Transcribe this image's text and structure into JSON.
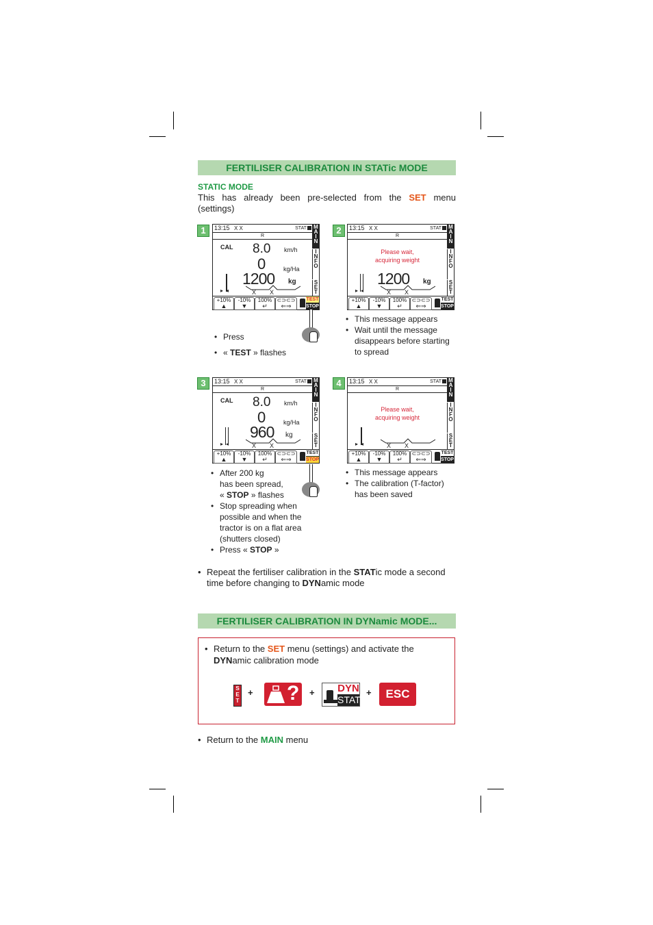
{
  "static_section": {
    "title": "FERTILISER CALIBRATION IN STATic MODE",
    "subtitle": "STATIC MODE",
    "intro_part1": "This has already been pre-selected from the",
    "intro_set": "SET",
    "intro_part2": "menu (settings)"
  },
  "screens": [
    {
      "step": "1",
      "time": "13:15",
      "xx": "X X",
      "stat": "STAT",
      "sub": "R",
      "cal": "CAL",
      "speed": "8.0",
      "speed_unit": "km/h",
      "rate": "0",
      "rate_unit": "kg/Ha",
      "weight": "1200",
      "weight_unit": "kg",
      "message": "",
      "flash": "TEST"
    },
    {
      "step": "2",
      "time": "13:15",
      "xx": "X X",
      "stat": "STAT",
      "sub": "R",
      "message_line1": "Please wait,",
      "message_line2": "acquiring weight",
      "weight": "1200",
      "weight_unit": "kg"
    },
    {
      "step": "3",
      "time": "13:15",
      "xx": "X X",
      "stat": "STAT",
      "sub": "R",
      "cal": "CAL",
      "speed": "8.0",
      "speed_unit": "km/h",
      "rate": "0",
      "rate_unit": "kg/Ha",
      "weight": "960",
      "weight_unit": "kg",
      "flash": "STOP"
    },
    {
      "step": "4",
      "time": "13:15",
      "xx": "X X",
      "stat": "STAT",
      "sub": "R",
      "message_line1": "Please wait,",
      "message_line2": "acquiring weight"
    }
  ],
  "sidebar": {
    "main": "MAIN",
    "info": "INFO",
    "set": "SET"
  },
  "buttons": {
    "plus10": "+10%",
    "minus10": "-10%",
    "hundred": "100%",
    "test": "TEST",
    "stop": "STOP"
  },
  "notes": {
    "step1": [
      "Press",
      "« ",
      "TEST",
      " » flashes"
    ],
    "step2": [
      "This message appears",
      "Wait until the message disappears before starting to spread"
    ],
    "step3": {
      "b1_line1": "After 200 kg",
      "b1_line2": "has been spread,",
      "b1_line3_pre": "« ",
      "b1_line3_bold": "STOP",
      "b1_line3_post": " » flashes",
      "b2": "Stop spreading when possible and when the tractor is on a flat area (shutters closed)",
      "b3_pre": "Press « ",
      "b3_bold": "STOP",
      "b3_post": " »"
    },
    "step4": [
      "This message appears",
      "The calibration (T-factor) has been saved"
    ]
  },
  "repeat_note": {
    "pre": "Repeat the fertiliser calibration in the",
    "bold1": "STAT",
    "mid": "ic mode a second time before changing to",
    "bold2": "DYN",
    "post": "amic mode"
  },
  "dynamic_section": {
    "title": "FERTILISER CALIBRATION IN DYNamic MODE...",
    "box_pre": "Return to the",
    "box_set": "SET",
    "box_mid": "menu (settings) and activate the",
    "box_bold": "DYN",
    "box_post": "amic calibration mode",
    "icons": {
      "set": "SET",
      "plus": "+",
      "weigh_q": "?",
      "dyn": "DYN",
      "stat": "STAT",
      "esc": "ESC"
    }
  },
  "final_note": {
    "pre": "Return to the",
    "main": "MAIN",
    "post": "menu"
  },
  "colors": {
    "banner_bg": "#b5d8b0",
    "banner_text": "#1b8a3d",
    "accent_orange": "#e4561a",
    "accent_red": "#d6293b",
    "box_border": "#c8202e",
    "step_green": "#6dbf70"
  }
}
